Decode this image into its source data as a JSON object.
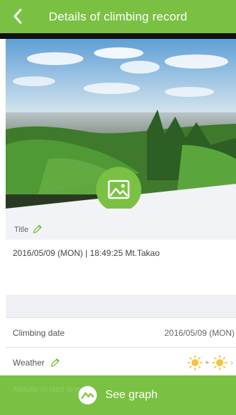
{
  "header": {
    "title": "Details of climbing record"
  },
  "title_row": {
    "label": "Title"
  },
  "record": {
    "info": "2016/05/09 (MON) | 18:49:25  Mt.Takao"
  },
  "details": {
    "climbing_date_label": "Climbing date",
    "climbing_date_value": "2016/05/09 (MON)",
    "weather_label": "Weather"
  },
  "footer": {
    "button_label": "See graph",
    "obscured_left": "Altitude in start time",
    "obscured_right": ""
  },
  "colors": {
    "accent": "#7ac143",
    "sun": "#f5c33b"
  },
  "icons": [
    "chevron-left-icon",
    "image-icon",
    "pencil-icon",
    "sun-icon",
    "graph-icon"
  ]
}
